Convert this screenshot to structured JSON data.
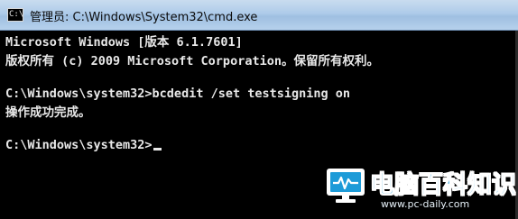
{
  "window": {
    "title": "管理员: C:\\Windows\\System32\\cmd.exe",
    "icon": "cmd-icon"
  },
  "console": {
    "lines": [
      "Microsoft Windows [版本 6.1.7601]",
      "版权所有 (c) 2009 Microsoft Corporation。保留所有权利。",
      "",
      "C:\\Windows\\system32>bcdedit /set testsigning on",
      "操作成功完成。",
      "",
      "C:\\Windows\\system32>"
    ]
  },
  "watermark": {
    "title": "电脑百科知识",
    "url": "www.pc-daily.com"
  },
  "colors": {
    "console_bg": "#000000",
    "console_fg": "#e8e8e8",
    "watermark_blue": "#1d9bd8"
  }
}
